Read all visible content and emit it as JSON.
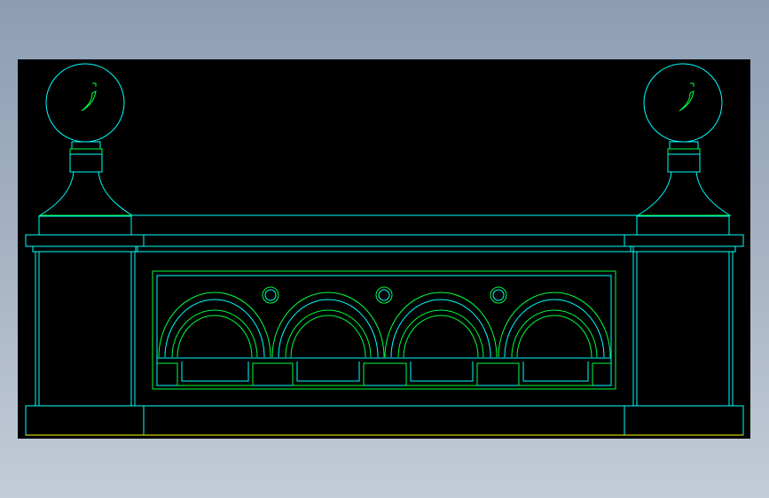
{
  "drawing": {
    "subject": "balustrade-elevation",
    "colors": {
      "background_outer": "#9aa8bb",
      "viewport": "#000000",
      "cyan_line": "#00ffff",
      "green_line": "#00ff3c",
      "yellow_line": "#ffff00"
    },
    "arch_count": 4,
    "medallion_count": 3,
    "finial_count": 2
  }
}
